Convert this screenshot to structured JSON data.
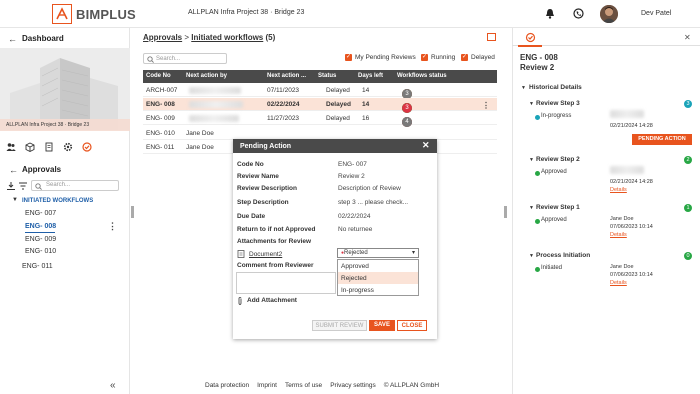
{
  "header": {
    "brand": "BIMPLUS",
    "project": "ALLPLAN Infra Project 38  ·  Bridge 23",
    "user": "Dev Patel"
  },
  "left": {
    "dashboard": "Dashboard",
    "image_caption": "ALLPLAN Infra Project 38  ·  Bridge 23",
    "approvals": "Approvals",
    "search_placeholder": "Search...",
    "section": "INITIATED WORKFLOWS",
    "items": [
      {
        "label": "ENG- 007"
      },
      {
        "label": "ENG- 008"
      },
      {
        "label": "ENG- 009"
      },
      {
        "label": "ENG- 010"
      },
      {
        "label": "ENG- 011"
      }
    ]
  },
  "center": {
    "breadcrumb": {
      "root": "Approvals",
      "sep": " > ",
      "current": "Initiated workflows",
      "count": "(5)"
    },
    "search_placeholder": "Search...",
    "filters": {
      "pending": "My Pending Reviews",
      "running": "Running",
      "delayed": "Delayed"
    },
    "columns": [
      "Code No",
      "Next action by",
      "Next action ...",
      "Status",
      "Days left",
      "Workflows status"
    ],
    "rows": [
      {
        "code": "ARCH-007",
        "by": "",
        "date": "07/11/2023",
        "status": "Delayed",
        "days": "14",
        "wf": [
          [
            "1",
            "g"
          ],
          [
            "1",
            "g"
          ],
          [
            "2",
            "r"
          ],
          [
            "3",
            "gr"
          ]
        ]
      },
      {
        "code": "ENG- 008",
        "by": "",
        "date": "02/22/2024",
        "status": "Delayed",
        "days": "14",
        "wf": [
          [
            "1",
            "g"
          ],
          [
            "1",
            "g"
          ],
          [
            "2",
            "g"
          ],
          [
            "3",
            "r"
          ]
        ]
      },
      {
        "code": "ENG- 009",
        "by": "",
        "date": "11/27/2023",
        "status": "Delayed",
        "days": "16",
        "wf": [
          [
            "1",
            "g"
          ],
          [
            "1",
            "r"
          ],
          [
            "2",
            "r"
          ],
          [
            "3",
            "gr"
          ],
          [
            "4",
            "gr"
          ]
        ]
      },
      {
        "code": "ENG- 010",
        "by": "Jane Doe",
        "date": "",
        "status": "",
        "days": "",
        "wf": []
      },
      {
        "code": "ENG- 011",
        "by": "Jane Doe",
        "date": "",
        "status": "",
        "days": "",
        "wf": []
      }
    ]
  },
  "dialog": {
    "title": "Pending Action",
    "fields": [
      {
        "k": "Code No",
        "v": "ENG- 007"
      },
      {
        "k": "Review Name",
        "v": "Review 2"
      },
      {
        "k": "Review Description",
        "v": "Description of Review"
      },
      {
        "k": "Step Description",
        "v": "step 3 ...  please check..."
      },
      {
        "k": "Due Date",
        "v": "02/22/2024"
      },
      {
        "k": "Return to if not Approved",
        "v": "No returnee"
      },
      {
        "k": "Attachments for Review",
        "v": ""
      }
    ],
    "document": "Document2",
    "select_value": "Rejected",
    "options": [
      "Approved",
      "Rejected",
      "In-progress"
    ],
    "comment_label": "Comment from Reviewer",
    "add_attachment": "Add Attachment",
    "submit": "SUBMIT REVIEW",
    "save": "SAVE",
    "close": "CLOSE"
  },
  "footer": [
    "Data protection",
    "Imprint",
    "Terms of use",
    "Privacy settings",
    "© ALLPLAN GmbH"
  ],
  "right": {
    "title1": "ENG - 008",
    "title2": "Review 2",
    "history": "Historical Details",
    "steps": [
      {
        "name": "Review Step 3",
        "status": "In-progress",
        "badge": "3",
        "date": "02/21/2024 14:28",
        "action": "PENDING ACTION"
      },
      {
        "name": "Review Step 2",
        "status": "Approved",
        "badge": "2",
        "date": "02/21/2024 14:28",
        "details": "Details"
      },
      {
        "name": "Review Step 1",
        "status": "Approved",
        "badge": "1",
        "person": "Jane Doe",
        "date": "07/06/2023 10:14",
        "details": "Details"
      },
      {
        "name": "Process Initiation",
        "status": "Initiated",
        "badge": "0",
        "person": "Jane Doe",
        "date": "07/06/2023 10:14",
        "details": "Details"
      }
    ]
  },
  "colors": {
    "accent": "#e8541e",
    "green": "#28a745",
    "red": "#dc3545",
    "header_dark": "#4a4a4a",
    "link_blue": "#1f5fa8"
  }
}
